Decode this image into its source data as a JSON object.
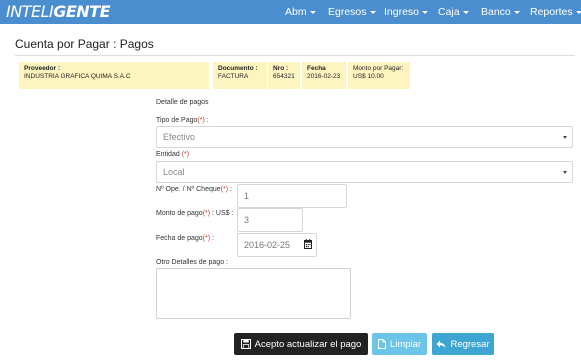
{
  "navbar": {
    "brand_part1": "INTELI",
    "brand_part2": "GENTE",
    "menu": [
      "Abm",
      "Egresos",
      "Ingreso",
      "Caja",
      "Banco",
      "Reportes"
    ],
    "color": "#4a8ed0"
  },
  "page": {
    "title": "Cuenta por Pagar : Pagos"
  },
  "info": {
    "proveedor_label": "Proveedor :",
    "proveedor_value": "INDUSTRIA GRAFICA QUIMA S.A.C",
    "documento_label": "Documento :",
    "documento_value": "FACTURA",
    "nro_label": "Nro :",
    "nro_value": "654321",
    "fecha_label": "Fecha",
    "fecha_value": "2016-02-23",
    "monto_label": "Monto por Pagar:",
    "monto_value": "US$ 10.00",
    "background": "#fdf5c0"
  },
  "form": {
    "section_title": "Detalle de pagos",
    "tipo_label": "Tipo de Pago",
    "tipo_suffix": " :",
    "tipo_value": "Efectivo",
    "entidad_label": "Entidad",
    "entidad_value": "Local",
    "nro_ope_label": "Nº Ope. / Nº Cheque",
    "nro_ope_suffix": " :",
    "nro_ope_value": "1",
    "monto_label": "Monto de pago",
    "monto_suffix": " : US$ :",
    "monto_value": "3",
    "fecha_label": "Fecha de pago",
    "fecha_suffix": " :",
    "fecha_value": "2016-02-25",
    "otros_label": "Otro Detalles de pago :",
    "required_mark": "(*)"
  },
  "buttons": {
    "accept": "Acepto actualizar el pago",
    "clear": "Limpiar",
    "back": "Regresar"
  }
}
